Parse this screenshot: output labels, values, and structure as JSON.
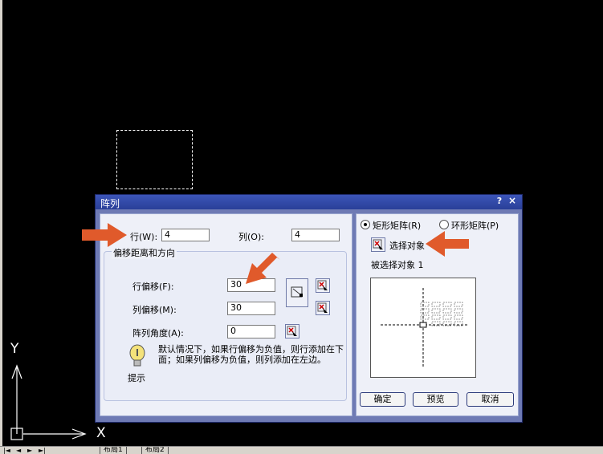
{
  "dialog": {
    "title": "阵列",
    "help": "?",
    "close": "×",
    "rows_label": "行(W):",
    "rows_value": "4",
    "cols_label": "列(O):",
    "cols_value": "4",
    "offset_group_title": "偏移距离和方向",
    "row_offset_label": "行偏移(F):",
    "row_offset_value": "30",
    "col_offset_label": "列偏移(M):",
    "col_offset_value": "30",
    "angle_label": "阵列角度(A):",
    "angle_value": "0",
    "hint_text": "默认情况下，如果行偏移为负值，则行添加在下面；如果列偏移为负值，则列添加在左边。",
    "hint_label": "提示",
    "rect_array_label": "矩形矩阵(R)",
    "polar_array_label": "环形矩阵(P)",
    "select_objects_label": "选择对象",
    "selected_count": "被选择对象 1",
    "ok_label": "确定",
    "preview_label": "预览",
    "cancel_label": "取消"
  },
  "ucs": {
    "x_label": "X",
    "y_label": "Y"
  },
  "tabs": {
    "tab1": "布局1",
    "tab2": "布局2"
  },
  "colors": {
    "arrow": "#e05a2b",
    "dialog_frame": "#6e7ab4",
    "titlebar": "#2a3f98"
  }
}
